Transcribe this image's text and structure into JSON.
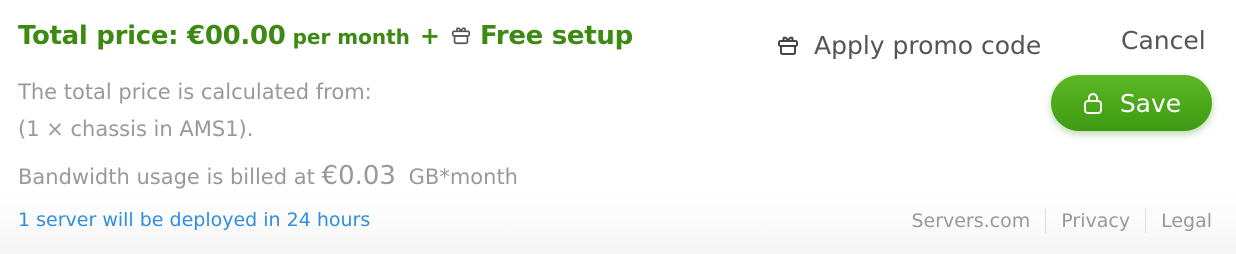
{
  "summary": {
    "total_label": "Total price: €00.00",
    "period": "per month",
    "plus": "+",
    "free_setup": "Free setup",
    "calc_line1": "The total price is calculated from:",
    "calc_line2": "(1 × chassis in AMS1).",
    "bandwidth_prefix": "Bandwidth usage is billed at",
    "bandwidth_price": "€0.03",
    "bandwidth_unit": "GB*month",
    "deploy_note": "1 server will be deployed in 24 hours"
  },
  "actions": {
    "promo_label": "Apply promo code",
    "cancel_label": "Cancel",
    "save_label": "Save"
  },
  "footer": {
    "links": [
      "Servers.com",
      "Privacy",
      "Legal"
    ]
  },
  "colors": {
    "price_green": "#3d8a12",
    "save_button": "#4caf1c",
    "link_blue": "#2f8ee0",
    "muted_gray": "#999999"
  },
  "icons": {
    "free_setup": "gift-icon",
    "promo": "gift-icon",
    "save": "lock-icon"
  }
}
